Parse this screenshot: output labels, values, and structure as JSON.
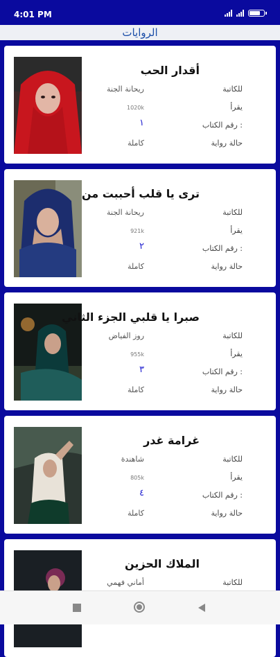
{
  "status": {
    "time": "4:01 PM",
    "battery": "79"
  },
  "header": {
    "title": "الروايات"
  },
  "labels": {
    "author": "للكاتبة",
    "reads": "يقرأ",
    "book_number": "رقم الكتاب :",
    "status": "حالة رواية"
  },
  "books": [
    {
      "title": "أقدار الحب",
      "author": "ريحانة الجنة",
      "reads": "1020k",
      "number": "١",
      "status": "كاملة"
    },
    {
      "title": "ترى يا قلب أحببت من",
      "author": "ريحانة الجنة",
      "reads": "921k",
      "number": "٢",
      "status": "كاملة"
    },
    {
      "title": "صبرا يا قلبي الجزء الثاني",
      "author": "روز الفياض",
      "reads": "955k",
      "number": "٣",
      "status": "كاملة"
    },
    {
      "title": "غرامة غدر",
      "author": "شاهندة",
      "reads": "805k",
      "number": "٤",
      "status": "كاملة"
    },
    {
      "title": "الملاك الحزين",
      "author": "أماني فهمي",
      "reads": "",
      "number": "",
      "status": ""
    }
  ],
  "colors": {
    "brand": "#0a0a9e",
    "title": "#1b4ea8",
    "number": "#1f1fd0"
  },
  "icons": {
    "recent": "square-icon",
    "home": "circle-icon",
    "back": "triangle-back-icon"
  }
}
